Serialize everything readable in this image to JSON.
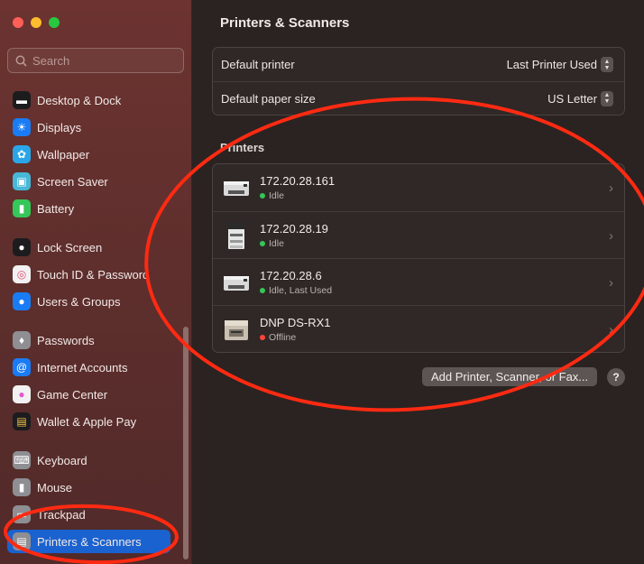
{
  "sidebar": {
    "search_placeholder": "Search",
    "groups": [
      [
        {
          "label": "Desktop & Dock",
          "icon": "desktop-dock-icon",
          "color": "#1c1c1e"
        },
        {
          "label": "Displays",
          "icon": "displays-icon",
          "color": "#1a7cf5"
        },
        {
          "label": "Wallpaper",
          "icon": "wallpaper-icon",
          "color": "#2aa6e8"
        },
        {
          "label": "Screen Saver",
          "icon": "screen-saver-icon",
          "color": "#48b8d8"
        },
        {
          "label": "Battery",
          "icon": "battery-icon",
          "color": "#35c759"
        }
      ],
      [
        {
          "label": "Lock Screen",
          "icon": "lock-icon",
          "color": "#1c1c1e"
        },
        {
          "label": "Touch ID & Password",
          "icon": "fingerprint-icon",
          "color": "#f2f2f2"
        },
        {
          "label": "Users & Groups",
          "icon": "users-icon",
          "color": "#1a7cf5"
        }
      ],
      [
        {
          "label": "Passwords",
          "icon": "key-icon",
          "color": "#8e8e93"
        },
        {
          "label": "Internet Accounts",
          "icon": "at-icon",
          "color": "#1a7cf5"
        },
        {
          "label": "Game Center",
          "icon": "game-center-icon",
          "color": "#f2f2f2"
        },
        {
          "label": "Wallet & Apple Pay",
          "icon": "wallet-icon",
          "color": "#1c1c1e"
        }
      ],
      [
        {
          "label": "Keyboard",
          "icon": "keyboard-icon",
          "color": "#8e8e93"
        },
        {
          "label": "Mouse",
          "icon": "mouse-icon",
          "color": "#8e8e93"
        },
        {
          "label": "Trackpad",
          "icon": "trackpad-icon",
          "color": "#8e8e93"
        },
        {
          "label": "Printers & Scanners",
          "icon": "printer-icon",
          "color": "#8e8e93",
          "selected": true
        }
      ]
    ]
  },
  "main": {
    "title": "Printers & Scanners",
    "settings": [
      {
        "label": "Default printer",
        "value": "Last Printer Used"
      },
      {
        "label": "Default paper size",
        "value": "US Letter"
      }
    ],
    "printers_heading": "Printers",
    "printers": [
      {
        "name": "172.20.28.161",
        "status": "Idle",
        "status_color": "#34c759",
        "thumb": "laser-printer-icon"
      },
      {
        "name": "172.20.28.19",
        "status": "Idle",
        "status_color": "#34c759",
        "thumb": "mfp-printer-icon"
      },
      {
        "name": "172.20.28.6",
        "status": "Idle, Last Used",
        "status_color": "#34c759",
        "thumb": "laser-printer-icon"
      },
      {
        "name": "DNP DS-RX1",
        "status": "Offline",
        "status_color": "#ff453a",
        "thumb": "photo-printer-icon"
      }
    ],
    "add_button": "Add Printer, Scanner, or Fax...",
    "help_button": "?"
  },
  "colors": {
    "accent": "#1a62cf",
    "annotation": "#ff2a12"
  }
}
